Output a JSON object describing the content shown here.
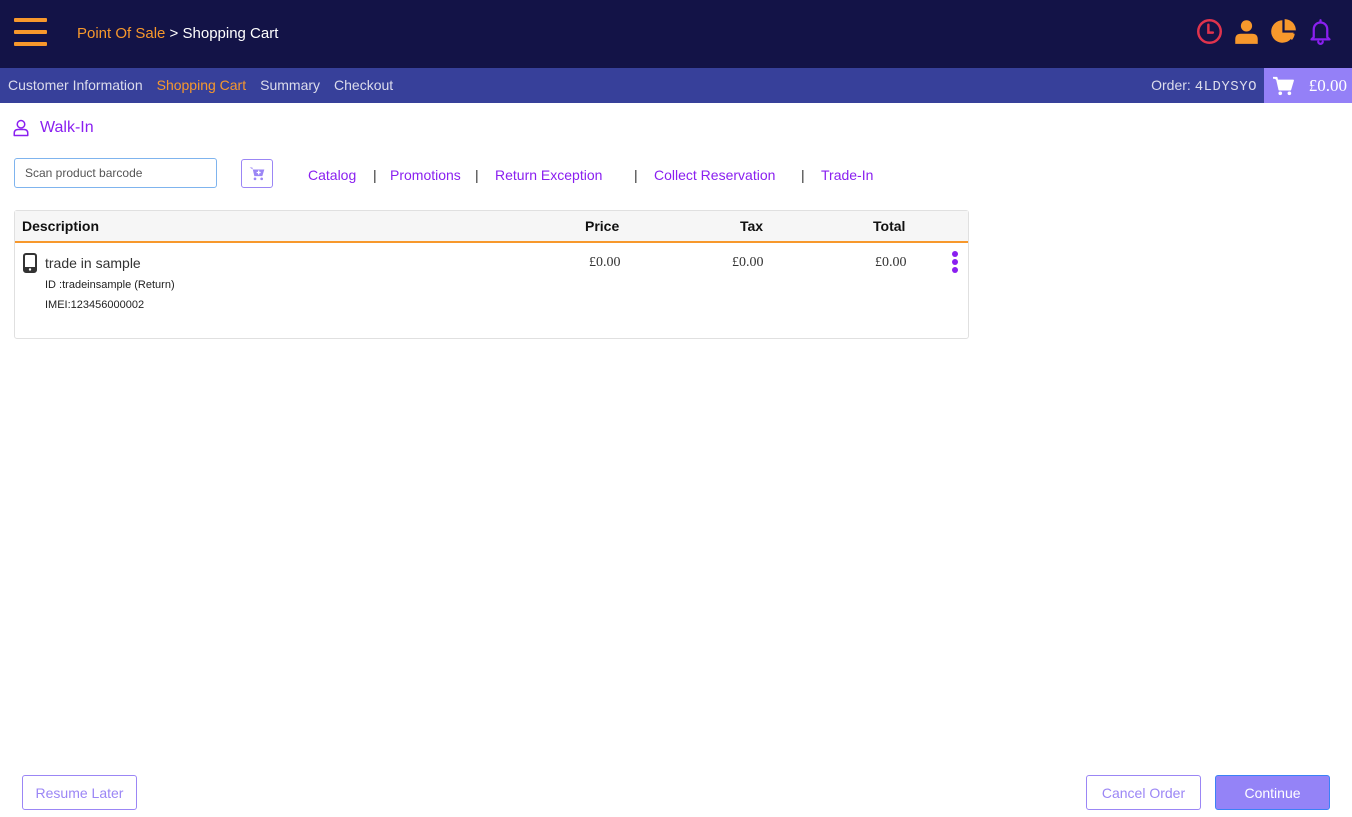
{
  "header": {
    "breadcrumb": {
      "root": "Point Of Sale",
      "separator": " > ",
      "current": "Shopping Cart"
    },
    "icons": [
      "clock-icon",
      "user-icon",
      "pie-chart-icon",
      "bell-icon"
    ],
    "colors": {
      "topbar": "#131347",
      "accent": "#f7982c",
      "clock": "#e0334d",
      "bell": "#8a1ff0"
    }
  },
  "steps": [
    {
      "label": "Customer Information",
      "active": false
    },
    {
      "label": "Shopping Cart",
      "active": true
    },
    {
      "label": "Summary",
      "active": false
    },
    {
      "label": "Checkout",
      "active": false
    }
  ],
  "order": {
    "label": "Order:",
    "code": "4LDYSYO",
    "cart_total": "£0.00"
  },
  "customer": {
    "name": "Walk-In"
  },
  "search": {
    "placeholder": "Scan product barcode",
    "value": ""
  },
  "links": [
    {
      "label": "Catalog"
    },
    {
      "label": "Promotions"
    },
    {
      "label": "Return Exception"
    },
    {
      "label": "Collect Reservation"
    },
    {
      "label": "Trade-In"
    }
  ],
  "link_separator": "|",
  "table": {
    "columns": [
      "Description",
      "Price",
      "Tax",
      "Total"
    ],
    "rows": [
      {
        "name": "trade in sample",
        "id_line": "ID :tradeinsample (Return)",
        "imei_line": "IMEI:123456000002",
        "price": "£0.00",
        "tax": "£0.00",
        "total": "£0.00"
      }
    ]
  },
  "footer": {
    "resume_later": "Resume Later",
    "cancel_order": "Cancel Order",
    "continue": "Continue"
  }
}
